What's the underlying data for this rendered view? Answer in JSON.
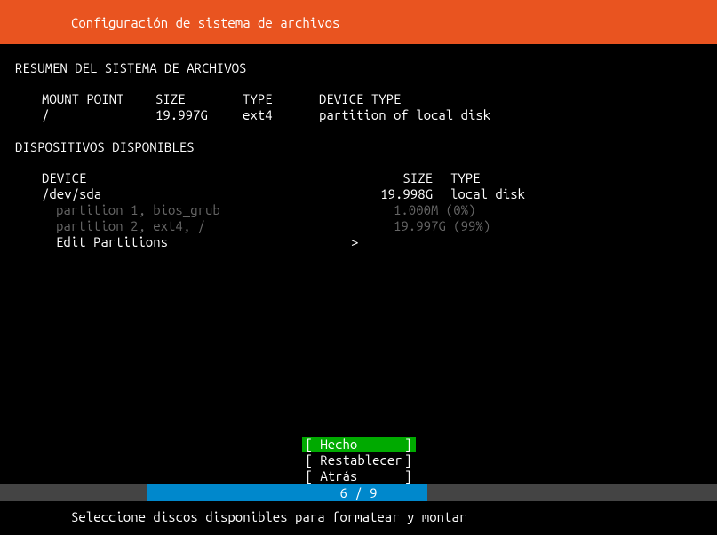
{
  "header": {
    "title": "Configuración de sistema de archivos"
  },
  "summary": {
    "title": "RESUMEN DEL SISTEMA DE ARCHIVOS",
    "headers": {
      "mount": "MOUNT POINT",
      "size": "SIZE",
      "type": "TYPE",
      "devtype": "DEVICE TYPE"
    },
    "rows": [
      {
        "mount": "/",
        "size": "19.997G",
        "type": "ext4",
        "devtype": "partition of local disk"
      }
    ]
  },
  "devices": {
    "title": "DISPOSITIVOS DISPONIBLES",
    "headers": {
      "device": "DEVICE",
      "size": "SIZE",
      "type": "TYPE"
    },
    "disk": {
      "name": "/dev/sda",
      "size": "19.998G",
      "type": "local disk"
    },
    "partitions": [
      {
        "label": "partition 1, bios_grub",
        "size": "1.000M (0%)"
      },
      {
        "label": "partition 2, ext4,  /",
        "size": "19.997G (99%)"
      }
    ],
    "edit": {
      "label": "Edit Partitions",
      "chevron": ">"
    }
  },
  "buttons": {
    "done": "Hecho",
    "reset": "Restablecer",
    "back": "Atrás"
  },
  "progress": {
    "current": "6",
    "total": "9",
    "sep": " / "
  },
  "footer": {
    "hint": "Seleccione discos disponibles para formatear y montar"
  }
}
